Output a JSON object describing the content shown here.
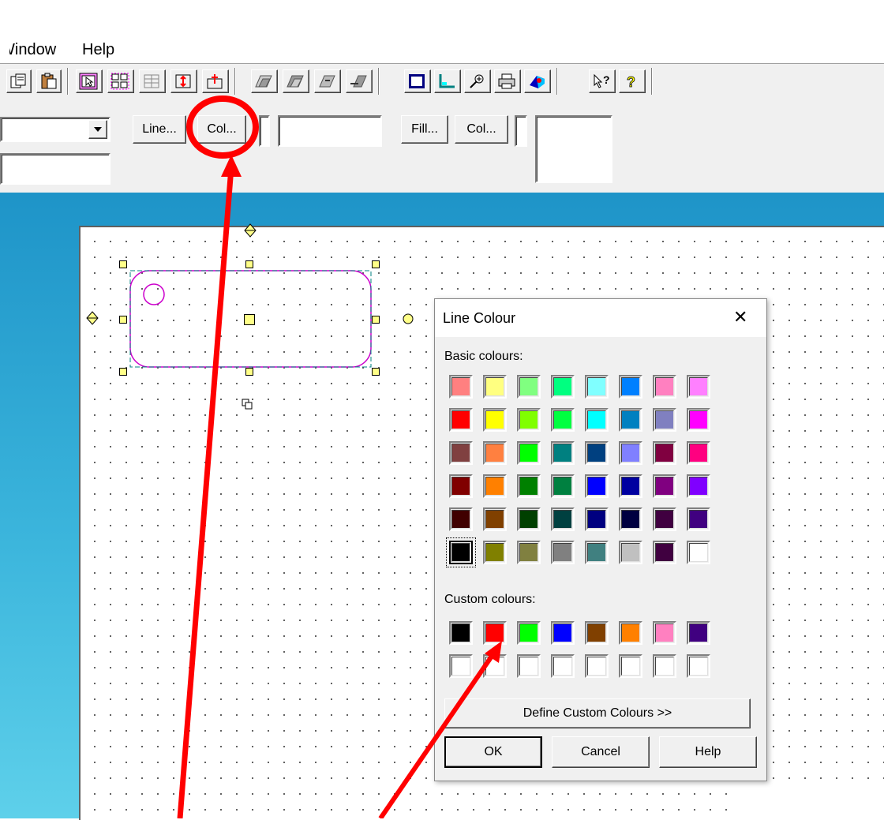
{
  "menu": {
    "window_label": "Window",
    "help_label": "Help"
  },
  "toolbar": {
    "line_button_label": "Line...",
    "line_col_button_label": "Col...",
    "fill_button_label": "Fill...",
    "fill_col_button_label": "Col..."
  },
  "dialog": {
    "title": "Line Colour",
    "close_glyph": "✕",
    "basic_colours_label": "Basic colours:",
    "custom_colours_label": "Custom colours:",
    "define_custom_label": "Define Custom Colours >>",
    "ok_label": "OK",
    "cancel_label": "Cancel",
    "help_label": "Help",
    "selected_basic_index": 40,
    "basic_colours": [
      "#ff8080",
      "#ffff80",
      "#80ff80",
      "#00ff80",
      "#80ffff",
      "#0080ff",
      "#ff80c0",
      "#ff80ff",
      "#ff0000",
      "#ffff00",
      "#80ff00",
      "#00ff40",
      "#00ffff",
      "#0080c0",
      "#8080c0",
      "#ff00ff",
      "#804040",
      "#ff8040",
      "#00ff00",
      "#008080",
      "#004080",
      "#8080ff",
      "#800040",
      "#ff0080",
      "#800000",
      "#ff8000",
      "#008000",
      "#008040",
      "#0000ff",
      "#0000a0",
      "#800080",
      "#8000ff",
      "#400000",
      "#804000",
      "#004000",
      "#004040",
      "#000080",
      "#000040",
      "#400040",
      "#400080",
      "#000000",
      "#808000",
      "#808040",
      "#808080",
      "#408080",
      "#c0c0c0",
      "#400040",
      "#ffffff"
    ],
    "custom_colours": [
      "#000000",
      "#ff0000",
      "#00ff00",
      "#0000ff",
      "#804000",
      "#ff8000",
      "#ff80c0",
      "#400080",
      "#ffffff",
      "#ffffff",
      "#ffffff",
      "#ffffff",
      "#ffffff",
      "#ffffff",
      "#ffffff",
      "#ffffff"
    ]
  },
  "annotation_color": "#ff0000",
  "icons": [
    "copy-icon",
    "paste-icon",
    "select-arrow-icon",
    "select-all-icon",
    "grid-icon",
    "rotate-icon",
    "flip-icon",
    "bring-front-icon",
    "send-back-icon",
    "forward-icon",
    "backward-icon",
    "frame-icon",
    "axis-icon",
    "zoom-icon",
    "print-icon",
    "3d-icon",
    "context-help-icon",
    "help-icon"
  ]
}
